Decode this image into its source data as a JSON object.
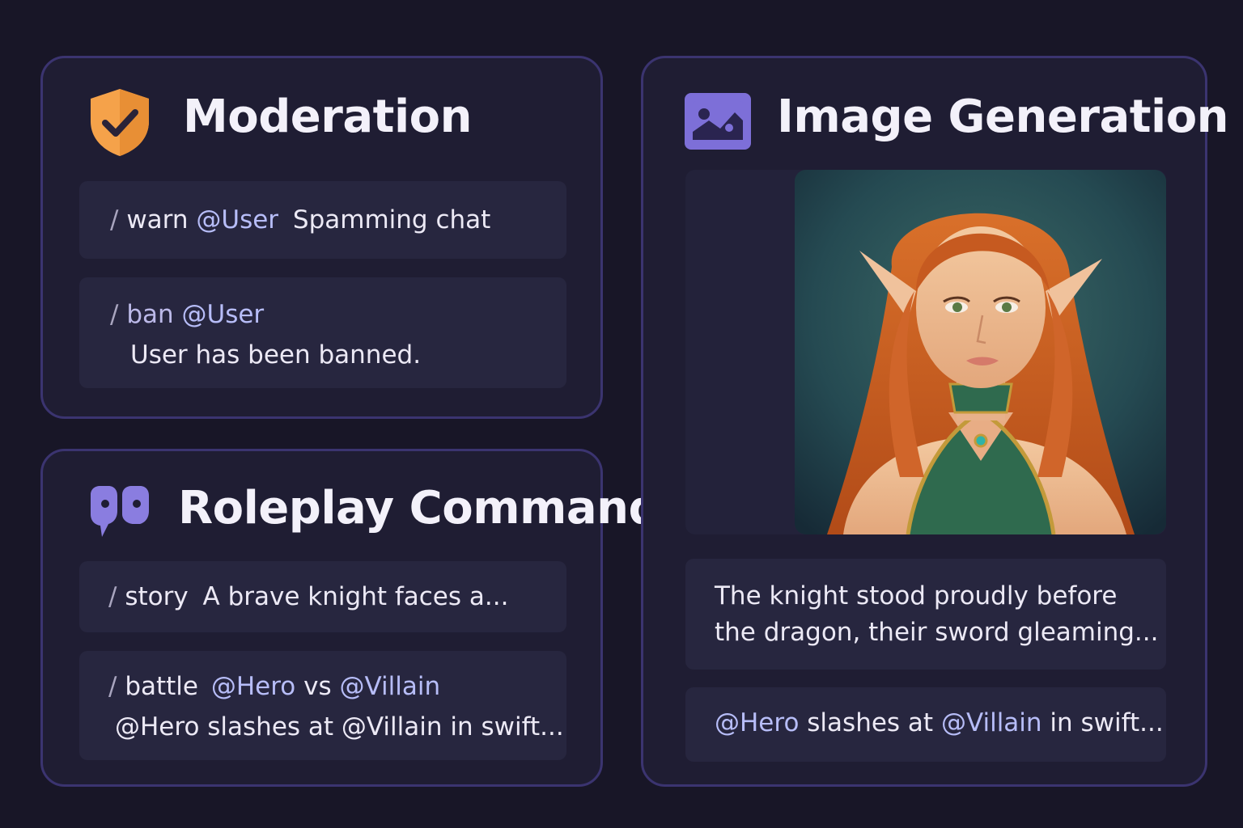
{
  "moderation": {
    "title": "Moderation",
    "icon": "shield-check-icon",
    "commands": [
      {
        "slash": "/",
        "name": "warn",
        "mention": "@User",
        "args": "Spamming chat",
        "response": ""
      },
      {
        "slash": "/",
        "name": "ban",
        "mention": "@User",
        "args": "",
        "response": "User has been banned."
      }
    ]
  },
  "roleplay": {
    "title": "Roleplay Commands",
    "icon": "quote-icon",
    "commands": [
      {
        "slash": "/",
        "name": "story",
        "args": "A brave knight faces a..."
      },
      {
        "slash": "/",
        "name": "battle",
        "mention_a": "@Hero",
        "vs": "vs",
        "mention_b": "@Villain",
        "response": "@Hero slashes at @Villain in swift..."
      }
    ]
  },
  "image_generation": {
    "title": "Image Generation",
    "icon": "image-icon",
    "image_icon": "elf-portrait-image",
    "caption_lines": [
      "The knight stood proudly before",
      "the dragon, their sword gleaming..."
    ],
    "reply": {
      "mention_a": "@Hero",
      "text_a": "slashes at",
      "mention_b": "@Villain",
      "text_b": "in swift..."
    }
  },
  "colors": {
    "background": "#181627",
    "card": "#1f1d33",
    "card_border": "#3b3470",
    "command_box": "#27263f",
    "mention": "#b7bdf8",
    "shield": "#f5a24a",
    "accent_purple": "#7d6fd8"
  }
}
